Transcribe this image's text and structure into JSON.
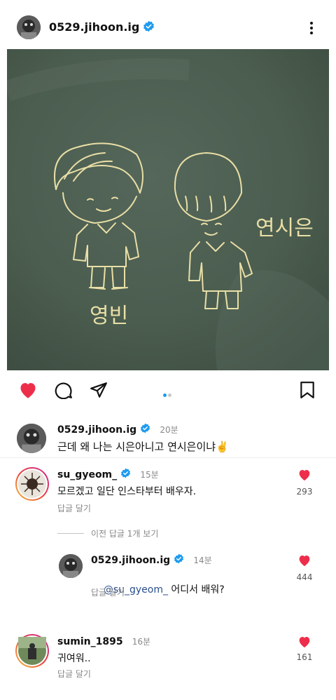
{
  "post": {
    "username": "0529.jihoon.ig",
    "image_alt": "chalk drawing on a green chalkboard",
    "drawing_labels": [
      "연시은",
      "영빈"
    ],
    "carousel": {
      "count": 2,
      "active": 0
    }
  },
  "caption": {
    "username": "0529.jihoon.ig",
    "time": "20분",
    "text": "근데 왜 나는 시은아니고 연시은이냐✌️"
  },
  "comments": [
    {
      "username": "su_gyeom_",
      "verified": true,
      "time": "15분",
      "text": "모르겠고 일단 인스타부터 배우자.",
      "reply_label": "답글 달기",
      "likes": "293",
      "view_replies": "이전 답글 1개 보기",
      "replies": [
        {
          "username": "0529.jihoon.ig",
          "verified": true,
          "time": "14분",
          "mention": "@su_gyeom_",
          "text": " 어디서 배워?",
          "reply_label": "답글 달기",
          "likes": "444"
        }
      ]
    },
    {
      "username": "sumin_1895",
      "verified": false,
      "time": "16분",
      "text": "귀여워..",
      "reply_label": "답글 달기",
      "likes": "161"
    }
  ],
  "colors": {
    "heart": "#ed2e4b",
    "verified": "#1d9bf0",
    "mention": "#2a4e8e",
    "chalkboard": "#4d5e4f",
    "chalk": "#e9dfa6"
  }
}
